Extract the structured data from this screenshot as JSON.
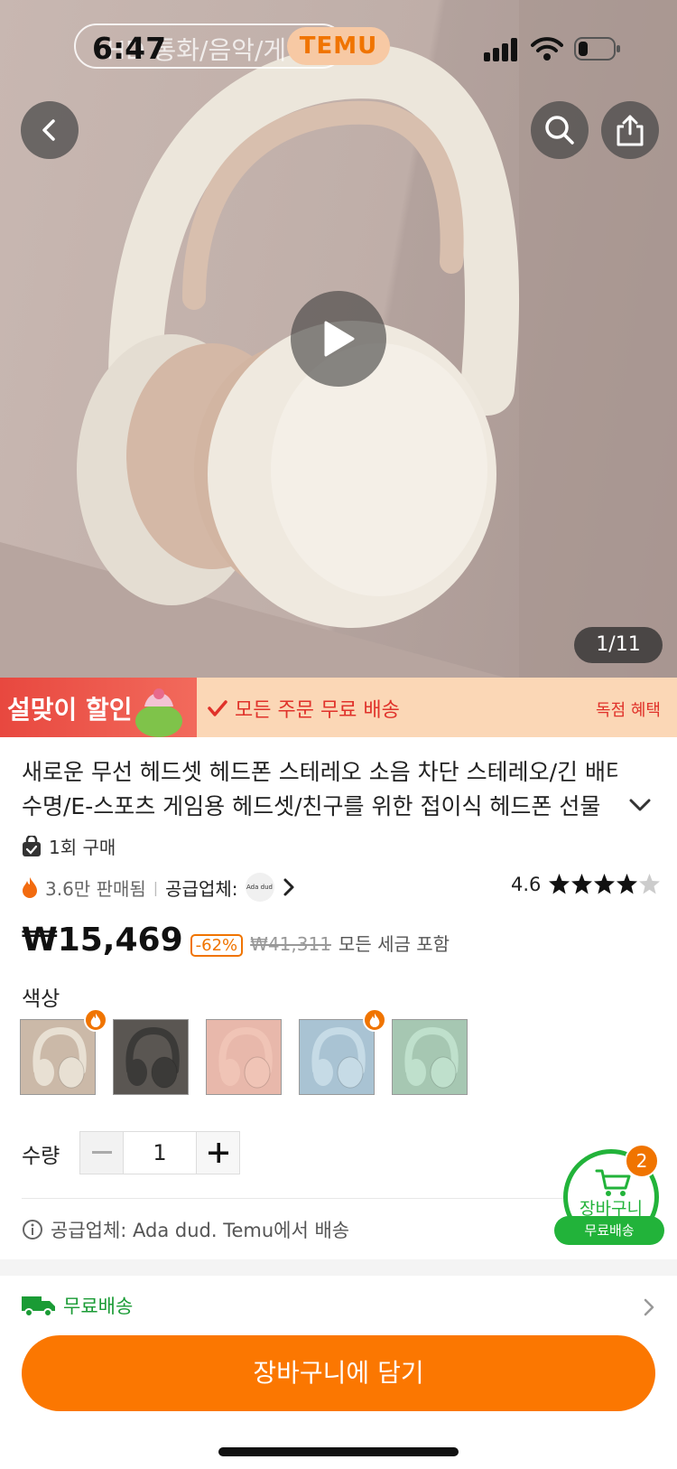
{
  "status_bar": {
    "time": "6:47",
    "call_text": "HD 통화/음악/게",
    "app_badge": "TEMU"
  },
  "hero": {
    "image_label": "headphones-product-photo",
    "page_indicator": "1/11"
  },
  "promo": {
    "left_label": "설맞이 할인",
    "middle_label": "모든 주문 무료 배송",
    "right_label": "독점 혜택"
  },
  "product": {
    "title_line1": "새로운 무선 헤드셋 헤드폰 스테레오 소음 차단 스테레오/긴 배터리",
    "title_line2": "수명/E-스포츠 게임용 헤드셋/친구를 위한 접이식 헤드폰 선물",
    "purchase_count": "1회 구매",
    "sold": "3.6만 판매됨",
    "supplier_label": "공급업체:",
    "supplier_logo_text": "Ada dud",
    "rating": "4.6",
    "rating_value": 4.6
  },
  "price": {
    "current": "₩15,469",
    "discount": "-62%",
    "original": "₩41,311",
    "tax_note": "모든 세금 포함"
  },
  "color": {
    "label": "색상",
    "options": [
      {
        "name": "cream",
        "hex": "#e8e0d3",
        "bg": "#cbb9a8",
        "hot": true
      },
      {
        "name": "black",
        "hex": "#3b3a38",
        "bg": "#5a5652",
        "hot": false
      },
      {
        "name": "pink",
        "hex": "#f0c4b6",
        "bg": "#e8b8ab",
        "hot": false
      },
      {
        "name": "blue",
        "hex": "#c6dbe6",
        "bg": "#a9c3d3",
        "hot": true
      },
      {
        "name": "green",
        "hex": "#bfe0cc",
        "bg": "#a6c7b2",
        "hot": false
      }
    ]
  },
  "quantity": {
    "label": "수량",
    "value": "1"
  },
  "supplier_info": "공급업체: Ada dud. Temu에서 배송",
  "cart": {
    "count": "2",
    "label": "장바구니",
    "free_label": "무료배송"
  },
  "shipping": {
    "label": "무료배송"
  },
  "add_to_cart": "장바구니에 담기",
  "colors": {
    "accent": "#fb7701",
    "green": "#22b33a",
    "promo_red": "#e0322a"
  }
}
